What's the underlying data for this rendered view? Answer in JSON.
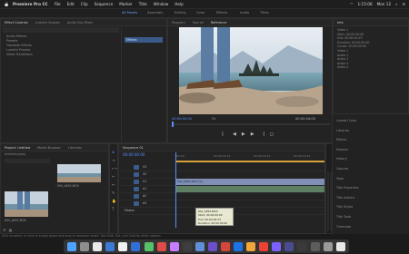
{
  "menubar": {
    "app": "Premiere Pro CC",
    "items": [
      "File",
      "Edit",
      "Clip",
      "Sequence",
      "Marker",
      "Title",
      "Window",
      "Help"
    ],
    "status_time": "Mon 12",
    "status_battery": "1:15:06"
  },
  "workspaces": [
    {
      "label": "All Panels",
      "active": true
    },
    {
      "label": "Assembly",
      "active": false
    },
    {
      "label": "Editing",
      "active": false
    },
    {
      "label": "Color",
      "active": false
    },
    {
      "label": "Effects",
      "active": false
    },
    {
      "label": "Audio",
      "active": false
    },
    {
      "label": "Titles",
      "active": false
    }
  ],
  "left_panel": {
    "tabs": [
      "Effect Controls",
      "Lumetri Scopes",
      "Audio Clip Mixer"
    ],
    "items": [
      "Audio Effects",
      "Presets",
      "Obsolete Effects",
      "Lumetri Presets",
      "Video Transitions"
    ],
    "selected_item": "Effects"
  },
  "program_monitor": {
    "tabs": [
      "Program",
      "Source",
      "Reference"
    ],
    "timecode_left": "00:00:00:00",
    "timecode_right": "00:00:04:00",
    "fit": "Fit"
  },
  "info_panel": {
    "title": "Info",
    "lines": [
      "Video 1",
      "Start: 00:00:00:00",
      "End: 00:00:04:23",
      "Duration: 00:00:05:00",
      "Cursor: 00:00:00:00",
      "Video 1",
      "Audio 1",
      "Audio 2",
      "Audio 3",
      "Audio 4"
    ]
  },
  "right_panels": [
    "Lumetri Color",
    "Libraries",
    "Effects",
    "Markers",
    "History",
    "Capture",
    "Tools",
    "Title Properties",
    "Title Actions",
    "Title Styles",
    "Title Tools",
    "Timecode"
  ],
  "project_panel": {
    "tabs": [
      "Project: Untitled",
      "Media Browser",
      "Libraries"
    ],
    "search_placeholder": "",
    "clip_name": "Untitled.prproj",
    "items": [
      {
        "name": "MVI_4893.MOV"
      },
      {
        "name": "MVI_4893.MOV"
      }
    ]
  },
  "timeline": {
    "sequence_name": "Sequence 01",
    "timecode": "00:00:00:00",
    "ruler": [
      "00:00",
      "00:00:04:23",
      "00:00:09:23",
      "00:00:14:23"
    ],
    "tracks": [
      "V3",
      "V2",
      "V1",
      "A1",
      "A2",
      "A3",
      "Master"
    ],
    "clip_label": "MVI_4893.MOV [V]",
    "tooltip_lines": [
      "MVI_4893.MOV",
      "Start: 00:00:00:00",
      "End: 00:00:04:23",
      "Duration: 00:00:05:00"
    ]
  },
  "hint_text": "Click to select, or click in empty space and drag to marquee select. Use Shift, Opt, and Cmd for other options.",
  "dock_colors": [
    "#4da3ff",
    "#8e8e8e",
    "#e8e8e8",
    "#3a7bd5",
    "#f0f0f0",
    "#2f6fd6",
    "#56c16a",
    "#e04a4a",
    "#c77dff",
    "#3e3e3e",
    "#5f8fd6",
    "#6b4ec8",
    "#d7463d",
    "#1b73e8",
    "#f0a73a",
    "#ea4335",
    "#7b61ff",
    "#4b4b8f",
    "#3a3a3a",
    "#5c5c5c",
    "#9a9a9a",
    "#e8e8e8"
  ]
}
